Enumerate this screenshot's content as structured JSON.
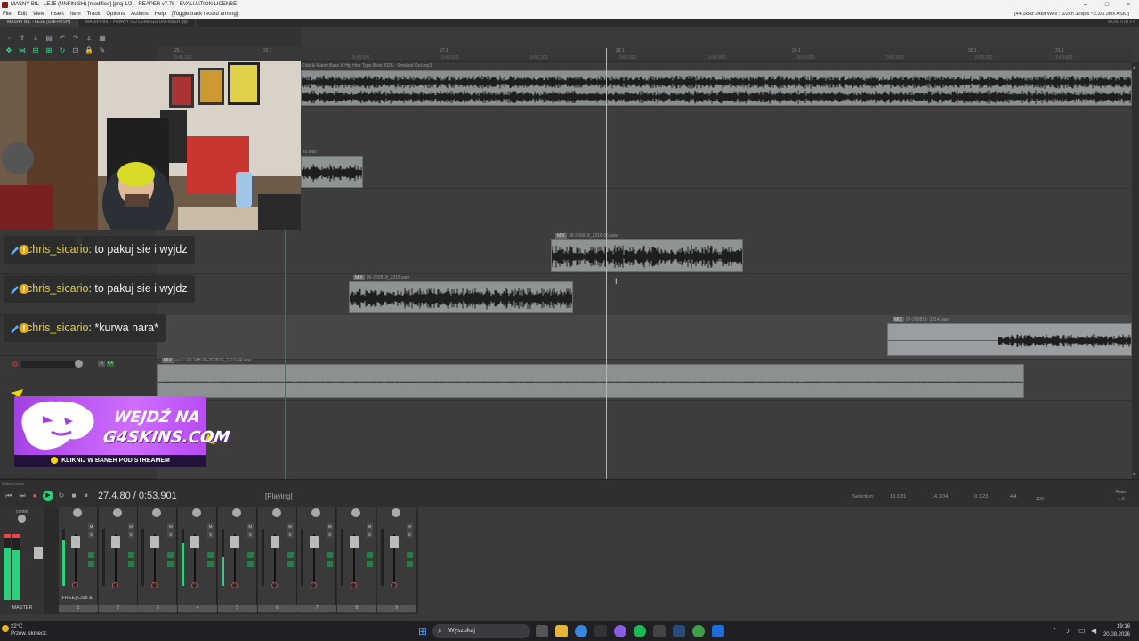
{
  "window": {
    "title": "MASNY BIL - LEJE (UNFINISH) [modified] [proj 1/2] - REAPER v7.78 - EVALUATION LICENSE",
    "audio_status": "[44.1kHz 24bit WAV : 2/2ch 32spls ~2.3/3.3ms ASIO]",
    "buttons": [
      "–",
      "□",
      "×"
    ]
  },
  "menu": [
    "File",
    "Edit",
    "View",
    "Insert",
    "Item",
    "Track",
    "Options",
    "Actions",
    "Help",
    "[Toggle track record arming]"
  ],
  "tabs": {
    "items": [
      "MASNY BIL - LEJE (UNFINISH)",
      "MASNY BIL - PRAWY DO LEWEGO UNFINISH.rpp"
    ],
    "right": "MONITOR FX"
  },
  "ruler": {
    "bars": [
      "25.1",
      "26.1",
      "27.1",
      "28.1",
      "29.1",
      "30.1",
      "31.1"
    ],
    "subs": [
      "0:46.320",
      "0:48.000",
      "0:49.600",
      "0:51.200",
      "0:52.800",
      "0:54.400",
      "0:56.000",
      "0:57.600",
      "0:59.200",
      "1:00.800"
    ]
  },
  "items": {
    "beat": "Club & Miami Bass & Hip Hop Type Beat 2026 - Smoked Out.mp3",
    "vox1": "43.wav",
    "vox2": "09-260818_2316-06.wav",
    "vox3": "06-260818_2315.wav",
    "vox4": "07-260818_2314.wav",
    "vox5": "<< 1:-63.3dB 08-260818_2313-04.wav",
    "mix_badge": "MIX"
  },
  "chat": [
    {
      "user": "chris_sicario",
      "message": "to pakuj sie i wyjdz"
    },
    {
      "user": "chris_sicario",
      "message": "to pakuj sie i wyjdz"
    },
    {
      "user": "chris_sicario",
      "message": "*kurwa nara*"
    }
  ],
  "banner": {
    "line1": "WEJDŹ NA",
    "line2": "G4SKINS.COM",
    "sub": "KLIKNIJ W BANER POD STREAMEM"
  },
  "transport": {
    "hint": "Select tone",
    "time": "27.4.80 / 0:53.901",
    "state": "[Playing]",
    "selection_label": "Selection:",
    "sel_start": "13.3.81",
    "sel_end": "14.1.04",
    "sel_len": "0.1.23",
    "time_sig": "4/4",
    "bpm": "120",
    "rate_label": "Rate",
    "rate_value": "1.0"
  },
  "mixer": {
    "master_label": "MASTER",
    "center": "center",
    "strips": [
      {
        "name": "[FREE] Club &",
        "num": "1",
        "level": 0.8
      },
      {
        "name": "",
        "num": "2",
        "level": 0
      },
      {
        "name": "",
        "num": "3",
        "level": 0
      },
      {
        "name": "",
        "num": "4",
        "level": 0.75
      },
      {
        "name": "",
        "num": "5",
        "level": 0.5
      },
      {
        "name": "",
        "num": "6",
        "level": 0
      },
      {
        "name": "",
        "num": "7",
        "level": 0
      },
      {
        "name": "",
        "num": "8",
        "level": 0
      },
      {
        "name": "",
        "num": "9",
        "level": 0
      }
    ]
  },
  "taskbar": {
    "temp": "22°C",
    "weather": "Przew. słonecz.",
    "search": "Wyszukaj",
    "time": "19:16",
    "date": "20.08.2026"
  },
  "colors": {
    "accent_green": "#27d37a",
    "playhead": "#c9b77c",
    "chat_user": "#e6d23a",
    "banner_purple": "#b549f2"
  }
}
